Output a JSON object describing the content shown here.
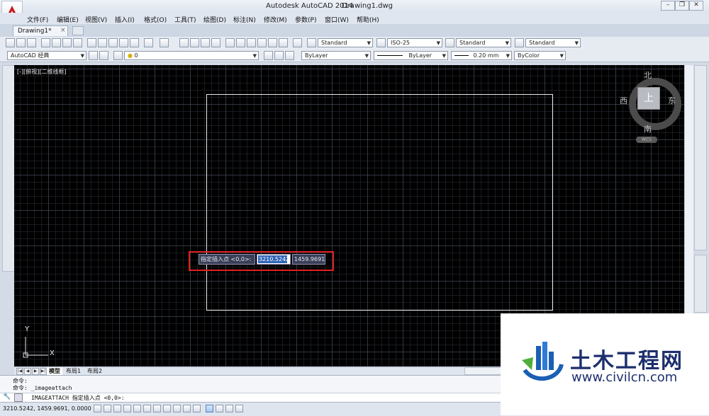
{
  "window": {
    "app_title": "Autodesk AutoCAD 2014",
    "file_title": "Drawing1.dwg"
  },
  "menu": [
    "文件(F)",
    "编辑(E)",
    "视图(V)",
    "插入(I)",
    "格式(O)",
    "工具(T)",
    "绘图(D)",
    "标注(N)",
    "修改(M)",
    "参数(P)",
    "窗口(W)",
    "帮助(H)"
  ],
  "tabs": {
    "doc_tab": "Drawing1*",
    "close": "×"
  },
  "toolbar1": {
    "text_style": "Standard",
    "dim_style": "ISO-25",
    "table_style": "Standard",
    "mleader_style": "Standard"
  },
  "toolbar2": {
    "workspace": "AutoCAD 经典",
    "layer": "0",
    "color": "ByLayer",
    "linetype": "ByLayer",
    "lineweight": "0.20 mm",
    "plotstyle": "ByColor"
  },
  "canvas": {
    "viewport_label": "[-][俯视][二维线框]",
    "ucs_x": "X",
    "ucs_y": "Y"
  },
  "viewcube": {
    "north": "北",
    "south": "南",
    "east": "东",
    "west": "西",
    "top": "上",
    "wcs": "WCS"
  },
  "dynamic_input": {
    "prompt": "指定插入点 <0,0>:",
    "x_value": "3210.5242",
    "y_value": "1459.9691"
  },
  "layout_tabs": [
    "模型",
    "布局1",
    "布局2"
  ],
  "command": {
    "history": [
      "命令:",
      "命令:  _imageattach"
    ],
    "current": "IMAGEATTACH 指定插入点 <0,0>:"
  },
  "status": {
    "coordinates": "3210.5242,  1459.9691,  0.0000"
  },
  "watermark": {
    "name": "土木工程网",
    "url": "www.civilcn.com"
  },
  "colors": {
    "canvas_bg": "#000000",
    "highlight_box": "#e02020",
    "brand_blue": "#1d2f6e"
  }
}
